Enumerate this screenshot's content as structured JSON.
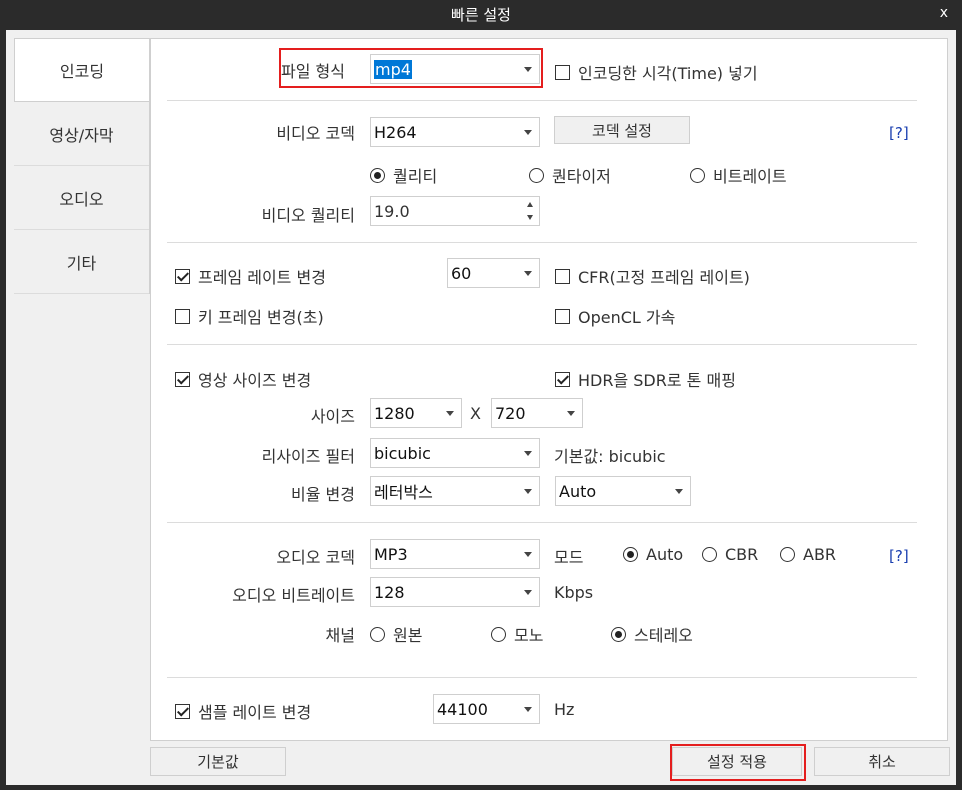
{
  "window": {
    "title": "빠른 설정",
    "close_label": "x"
  },
  "sidebar": {
    "items": [
      {
        "label": "인코딩"
      },
      {
        "label": "영상/자막"
      },
      {
        "label": "오디오"
      },
      {
        "label": "기타"
      }
    ]
  },
  "format": {
    "label": "파일 형식",
    "value": "mp4",
    "timestamp_checkbox": "인코딩한 시각(Time) 넣기",
    "timestamp_checked": false
  },
  "video": {
    "codec_label": "비디오 코덱",
    "codec_value": "H264",
    "codec_settings_button": "코덱 설정",
    "help": "[?]",
    "mode_options": [
      "퀄리티",
      "퀀타이저",
      "비트레이트"
    ],
    "mode_selected": "퀄리티",
    "quality_label": "비디오 퀄리티",
    "quality_value": "19.0"
  },
  "frame": {
    "change_rate_label": "프레임 레이트 변경",
    "change_rate_checked": true,
    "rate_value": "60",
    "cfr_label": "CFR(고정 프레임 레이트)",
    "cfr_checked": false,
    "keyframe_label": "키 프레임 변경(초)",
    "keyframe_checked": false,
    "opencl_label": "OpenCL 가속",
    "opencl_checked": false
  },
  "size": {
    "change_size_label": "영상 사이즈 변경",
    "change_size_checked": true,
    "hdr_label": "HDR을 SDR로 톤 매핑",
    "hdr_checked": true,
    "size_label": "사이즈",
    "width": "1280",
    "x_label": "X",
    "height": "720",
    "filter_label": "리사이즈 필터",
    "filter_value": "bicubic",
    "filter_default": "기본값: bicubic",
    "ratio_label": "비율 변경",
    "ratio_value": "레터박스",
    "ratio_mode": "Auto"
  },
  "audio": {
    "codec_label": "오디오 코덱",
    "codec_value": "MP3",
    "mode_label": "모드",
    "mode_options": [
      "Auto",
      "CBR",
      "ABR"
    ],
    "mode_selected": "Auto",
    "help": "[?]",
    "bitrate_label": "오디오 비트레이트",
    "bitrate_value": "128",
    "bitrate_unit": "Kbps",
    "channel_label": "채널",
    "channel_options": [
      "원본",
      "모노",
      "스테레오"
    ],
    "channel_selected": "스테레오"
  },
  "sample": {
    "label": "샘플 레이트 변경",
    "checked": true,
    "value": "44100",
    "unit": "Hz"
  },
  "footer": {
    "default_button": "기본값",
    "apply_button": "설정 적용",
    "cancel_button": "취소"
  },
  "colors": {
    "highlight": "#e41e1e",
    "selection": "#0078d7",
    "link": "#1a3fb0"
  }
}
